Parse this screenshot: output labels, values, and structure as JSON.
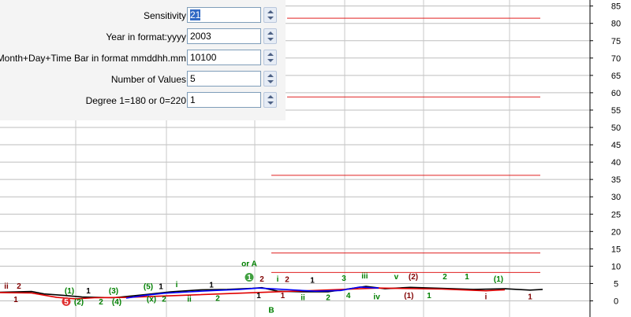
{
  "settings": {
    "fields": [
      {
        "label": "Sensitivity",
        "value": "21",
        "selected": true
      },
      {
        "label": "Year in format:yyyy",
        "value": "2003",
        "selected": false
      },
      {
        "label": "Month+Day+Time Bar in format mmddhh.mm",
        "value": "10100",
        "selected": false
      },
      {
        "label": "Number of Values",
        "value": "5",
        "selected": false
      },
      {
        "label": "Degree 1=180 or 0=220",
        "value": "1",
        "selected": false
      }
    ]
  },
  "chart_data": {
    "type": "line",
    "y_ticks": [
      "85",
      "80",
      "75",
      "70",
      "65",
      "60",
      "55",
      "50",
      "45",
      "40",
      "35",
      "30",
      "25",
      "20",
      "15",
      "10",
      "5",
      "0"
    ],
    "ylim": [
      0,
      85
    ],
    "grid": true,
    "levels": [
      {
        "y": 81.5,
        "x_start": 0.455
      },
      {
        "y": 58.8,
        "x_start": 0.455
      },
      {
        "y": 36.2,
        "x_start": 0.43
      },
      {
        "y": 13.8,
        "x_start": 0.43
      },
      {
        "y": 8.2,
        "x_start": 0.43
      }
    ],
    "series": [
      {
        "color": "#000000",
        "points": [
          [
            0,
            2.5
          ],
          [
            0.05,
            2.7
          ],
          [
            0.07,
            2.0
          ],
          [
            0.1,
            1.6
          ],
          [
            0.13,
            1.1
          ],
          [
            0.18,
            0.9
          ],
          [
            0.23,
            1.8
          ],
          [
            0.27,
            2.6
          ],
          [
            0.32,
            3.2
          ],
          [
            0.36,
            3.3
          ],
          [
            0.4,
            3.6
          ],
          [
            0.415,
            3.8
          ],
          [
            0.44,
            2.8
          ],
          [
            0.48,
            2.6
          ],
          [
            0.52,
            2.6
          ],
          [
            0.55,
            3.4
          ],
          [
            0.58,
            4.2
          ],
          [
            0.61,
            3.5
          ],
          [
            0.65,
            3.9
          ],
          [
            0.7,
            3.6
          ],
          [
            0.75,
            3.3
          ],
          [
            0.8,
            3.5
          ],
          [
            0.84,
            3.1
          ],
          [
            0.86,
            3.3
          ]
        ]
      },
      {
        "color": "#e00000",
        "points": [
          [
            0,
            2.4
          ],
          [
            0.05,
            2.3
          ],
          [
            0.09,
            1.0
          ],
          [
            0.12,
            0.6
          ],
          [
            0.15,
            0.9
          ],
          [
            0.2,
            1.0
          ],
          [
            0.6,
            3.7
          ],
          [
            0.7,
            3.4
          ],
          [
            0.77,
            2.9
          ],
          [
            0.8,
            3.2
          ]
        ]
      },
      {
        "color": "#0000ff",
        "points": [
          [
            0.2,
            0.8
          ],
          [
            0.23,
            1.6
          ],
          [
            0.26,
            2.2
          ],
          [
            0.3,
            2.6
          ],
          [
            0.34,
            3.0
          ],
          [
            0.38,
            3.3
          ],
          [
            0.41,
            3.7
          ],
          [
            0.5,
            2.8
          ],
          [
            0.54,
            3.0
          ],
          [
            0.57,
            4.0
          ],
          [
            0.6,
            3.7
          ]
        ]
      }
    ],
    "annotations": [
      {
        "text": "ii",
        "x": 0.01,
        "y": 3.5,
        "color": "#800000"
      },
      {
        "text": "2",
        "x": 0.03,
        "y": 3.5,
        "color": "#800000"
      },
      {
        "text": "1",
        "x": 0.025,
        "y": -0.3,
        "color": "#800000"
      },
      {
        "text": "5",
        "x": 0.105,
        "y": -1.0,
        "color": "#ffffff",
        "circle": "#e03030"
      },
      {
        "text": "(1)",
        "x": 0.11,
        "y": 2.2,
        "color": "#008000"
      },
      {
        "text": "(2)",
        "x": 0.125,
        "y": -1.0,
        "color": "#008000"
      },
      {
        "text": "1",
        "x": 0.14,
        "y": 2.2,
        "color": "#000000"
      },
      {
        "text": "2",
        "x": 0.16,
        "y": -1.0,
        "color": "#008000"
      },
      {
        "text": "(3)",
        "x": 0.18,
        "y": 2.2,
        "color": "#008000"
      },
      {
        "text": "(4)",
        "x": 0.185,
        "y": -1.0,
        "color": "#008000"
      },
      {
        "text": "(5)",
        "x": 0.235,
        "y": 3.4,
        "color": "#008000"
      },
      {
        "text": "1",
        "x": 0.255,
        "y": 3.4,
        "color": "#000000"
      },
      {
        "text": "(x)",
        "x": 0.24,
        "y": -0.2,
        "color": "#008000"
      },
      {
        "text": "2",
        "x": 0.26,
        "y": -0.2,
        "color": "#008000"
      },
      {
        "text": "i",
        "x": 0.28,
        "y": 4.0,
        "color": "#008000"
      },
      {
        "text": "ii",
        "x": 0.3,
        "y": -0.2,
        "color": "#008000"
      },
      {
        "text": "1",
        "x": 0.335,
        "y": 3.8,
        "color": "#000000"
      },
      {
        "text": "2",
        "x": 0.345,
        "y": 0.0,
        "color": "#008000"
      },
      {
        "text": "or A",
        "x": 0.395,
        "y": 10.0,
        "color": "#008000"
      },
      {
        "text": "1",
        "x": 0.395,
        "y": 6.0,
        "color": "#ffffff",
        "circle": "#40a040"
      },
      {
        "text": "2",
        "x": 0.415,
        "y": 5.6,
        "color": "#800000"
      },
      {
        "text": "1",
        "x": 0.41,
        "y": 0.8,
        "color": "#000000"
      },
      {
        "text": "i",
        "x": 0.44,
        "y": 5.6,
        "color": "#008000"
      },
      {
        "text": "2",
        "x": 0.455,
        "y": 5.4,
        "color": "#800000"
      },
      {
        "text": "1",
        "x": 0.448,
        "y": 0.8,
        "color": "#800000"
      },
      {
        "text": "B",
        "x": 0.43,
        "y": -3.4,
        "color": "#008000"
      },
      {
        "text": "ii",
        "x": 0.48,
        "y": 0.2,
        "color": "#008000"
      },
      {
        "text": "1",
        "x": 0.495,
        "y": 5.2,
        "color": "#000000"
      },
      {
        "text": "2",
        "x": 0.52,
        "y": 0.2,
        "color": "#008000"
      },
      {
        "text": "3",
        "x": 0.545,
        "y": 5.8,
        "color": "#008000"
      },
      {
        "text": "4",
        "x": 0.552,
        "y": 0.8,
        "color": "#008000"
      },
      {
        "text": "iii",
        "x": 0.578,
        "y": 6.5,
        "color": "#008000"
      },
      {
        "text": "iv",
        "x": 0.597,
        "y": 0.4,
        "color": "#008000"
      },
      {
        "text": "v",
        "x": 0.628,
        "y": 6.2,
        "color": "#008000"
      },
      {
        "text": "(2)",
        "x": 0.655,
        "y": 6.2,
        "color": "#800000"
      },
      {
        "text": "(1)",
        "x": 0.648,
        "y": 0.8,
        "color": "#800000"
      },
      {
        "text": "1",
        "x": 0.68,
        "y": 0.8,
        "color": "#008000"
      },
      {
        "text": "2",
        "x": 0.705,
        "y": 6.2,
        "color": "#008000"
      },
      {
        "text": "1",
        "x": 0.74,
        "y": 6.2,
        "color": "#008000"
      },
      {
        "text": "i",
        "x": 0.77,
        "y": 0.4,
        "color": "#800000"
      },
      {
        "text": "(1)",
        "x": 0.79,
        "y": 5.6,
        "color": "#008000"
      },
      {
        "text": "1",
        "x": 0.84,
        "y": 0.4,
        "color": "#800000"
      }
    ]
  }
}
